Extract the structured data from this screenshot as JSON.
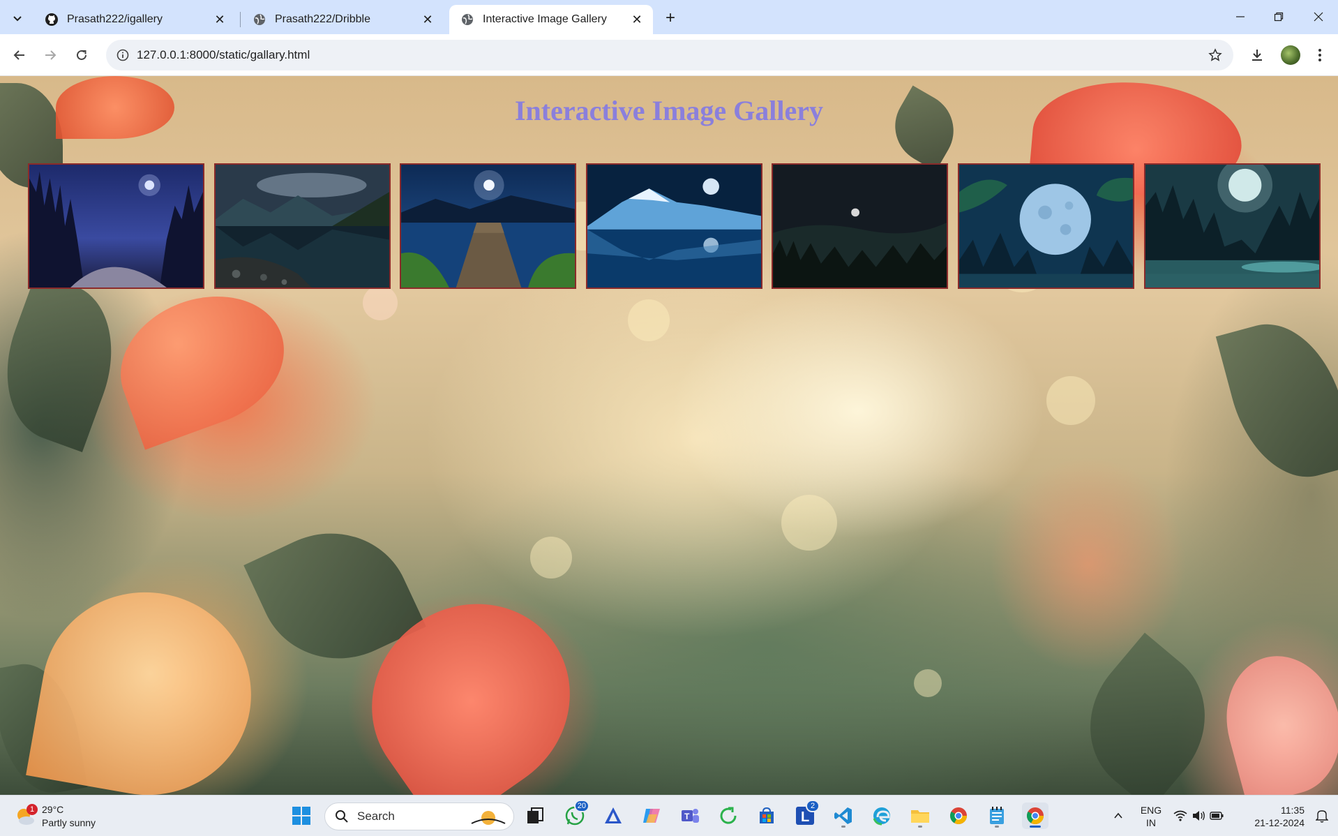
{
  "browser": {
    "tabs": [
      {
        "title": "Prasath222/igallery",
        "favicon": "github-icon",
        "active": false
      },
      {
        "title": "Prasath222/Dribble",
        "favicon": "globe-icon",
        "active": false
      },
      {
        "title": "Interactive Image Gallery",
        "favicon": "globe-icon",
        "active": true
      }
    ],
    "url": "127.0.0.1:8000/static/gallary.html"
  },
  "page": {
    "title": "Interactive Image Gallery",
    "title_color": "#8a7fdc",
    "border_color": "#8b2a2a",
    "images": [
      {
        "subject": "starry-night-forest"
      },
      {
        "subject": "mountain-lake-night"
      },
      {
        "subject": "moonlit-pier-lake"
      },
      {
        "subject": "snow-mountain-moon-lake"
      },
      {
        "subject": "dark-forest-moon"
      },
      {
        "subject": "full-moon-forest"
      },
      {
        "subject": "foggy-forest-moon"
      }
    ]
  },
  "taskbar": {
    "weather": {
      "temp": "29°C",
      "condition": "Partly sunny",
      "badge": "1"
    },
    "search_label": "Search",
    "apps": [
      {
        "name": "task-view-icon"
      },
      {
        "name": "whatsapp-icon",
        "badge": "20"
      },
      {
        "name": "vector-app-icon"
      },
      {
        "name": "copilot-icon"
      },
      {
        "name": "teams-icon"
      },
      {
        "name": "sync-app-icon"
      },
      {
        "name": "store-icon"
      },
      {
        "name": "l-app-icon",
        "badge": "2"
      },
      {
        "name": "vscode-icon"
      },
      {
        "name": "edge-icon"
      },
      {
        "name": "file-explorer-icon"
      },
      {
        "name": "chrome-icon"
      },
      {
        "name": "notepad-icon"
      },
      {
        "name": "chrome-active-icon"
      }
    ],
    "language": {
      "line1": "ENG",
      "line2": "IN"
    },
    "clock": {
      "time": "11:35",
      "date": "21-12-2024"
    }
  }
}
